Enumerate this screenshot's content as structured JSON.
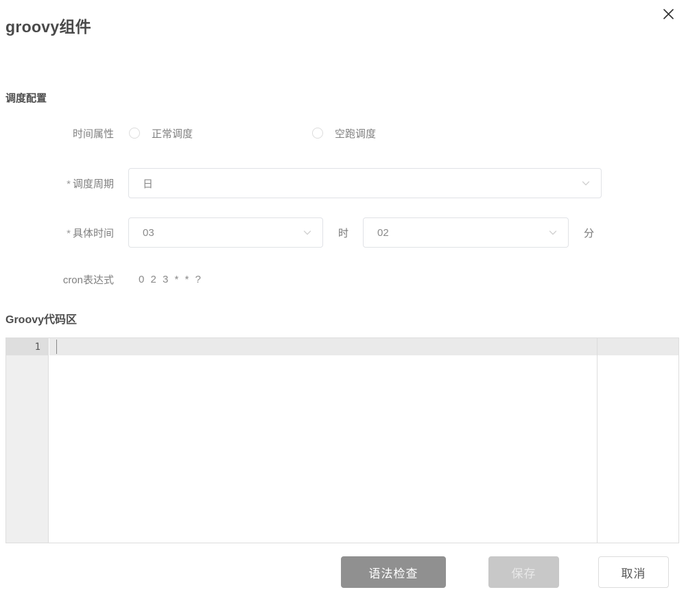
{
  "dialog": {
    "title": "groovy组件",
    "close_icon": "close-icon"
  },
  "schedule": {
    "section_title": "调度配置",
    "time_attribute": {
      "label": "时间属性",
      "options": [
        {
          "label": "正常调度",
          "checked": false
        },
        {
          "label": "空跑调度",
          "checked": false
        }
      ]
    },
    "cycle": {
      "label": "调度周期",
      "required_marker": "*",
      "value": "日",
      "caret_icon": "chevron-down-icon"
    },
    "specific_time": {
      "label": "具体时间",
      "required_marker": "*",
      "hour_value": "03",
      "hour_unit": "时",
      "minute_value": "02",
      "minute_unit": "分",
      "caret_icon": "chevron-down-icon"
    },
    "cron": {
      "label": "cron表达式",
      "value": "0 2 3 * * ?"
    }
  },
  "code": {
    "section_title": "Groovy代码区",
    "line_number": "1",
    "content": ""
  },
  "footer": {
    "syntax_check_label": "语法检查",
    "save_label": "保存",
    "cancel_label": "取消"
  },
  "colors": {
    "primary_button": "#909090",
    "disabled_button": "#c8c8c8",
    "border": "#e0e2e6",
    "text": "#808080"
  }
}
